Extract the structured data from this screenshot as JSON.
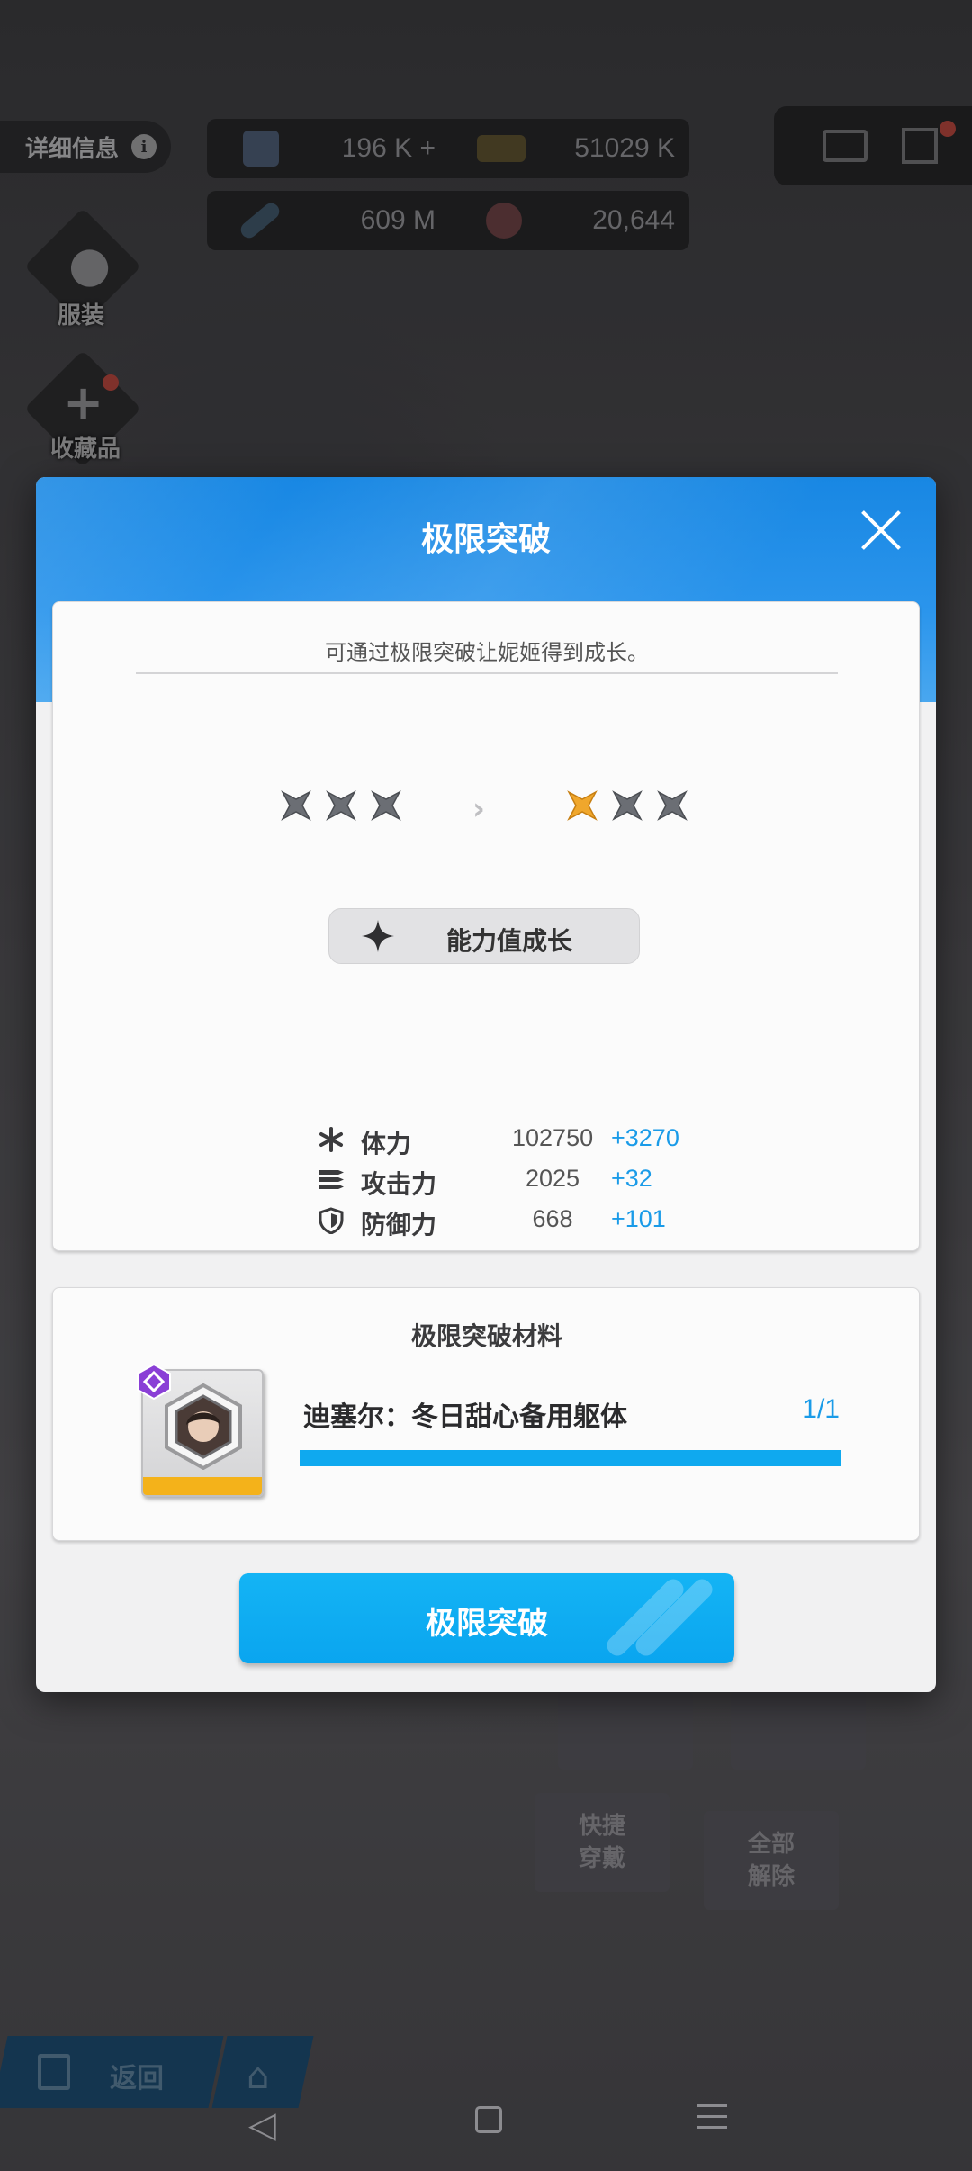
{
  "background": {
    "detail_label": "详细信息",
    "info_glyph": "i",
    "resources": [
      {
        "icon": "crystal-icon",
        "value": "196 K +"
      },
      {
        "icon": "credit-icon",
        "value": "51029 K"
      },
      {
        "icon": "battery-icon",
        "value": "609 M"
      },
      {
        "icon": "core-icon",
        "value": "20,644"
      }
    ],
    "costume_label": "服装",
    "collection_label": "收藏品",
    "quick_equip_label": "快捷\n穿戴",
    "unequip_all_label": "全部\n解除",
    "back_label": "返回"
  },
  "dialog": {
    "title": "极限突破",
    "description": "可通过极限突破让妮姬得到成长。",
    "stars_before": [
      "empty",
      "empty",
      "empty"
    ],
    "stars_after": [
      "filled",
      "empty",
      "empty"
    ],
    "arrow": "›",
    "growth_label": "能力值成长",
    "stats": [
      {
        "icon": "asterisk-icon",
        "label": "体力",
        "value": "102750",
        "increase": "+3270"
      },
      {
        "icon": "bullets-icon",
        "label": "攻击力",
        "value": "2025",
        "increase": "+32"
      },
      {
        "icon": "shield-icon",
        "label": "防御力",
        "value": "668",
        "increase": "+101"
      }
    ],
    "materials_title": "极限突破材料",
    "material": {
      "name": "迪塞尔：冬日甜心备用躯体",
      "count": "1/1",
      "progress": 1.0
    },
    "confirm_label": "极限突破"
  },
  "colors": {
    "accent": "#0fa9ef",
    "header_blue": "#1887e3",
    "star_filled": "#f0a72c",
    "star_empty": "#6b6e74",
    "increase_text": "#1a9be8",
    "rarity_purple": "#8a3fd6"
  }
}
